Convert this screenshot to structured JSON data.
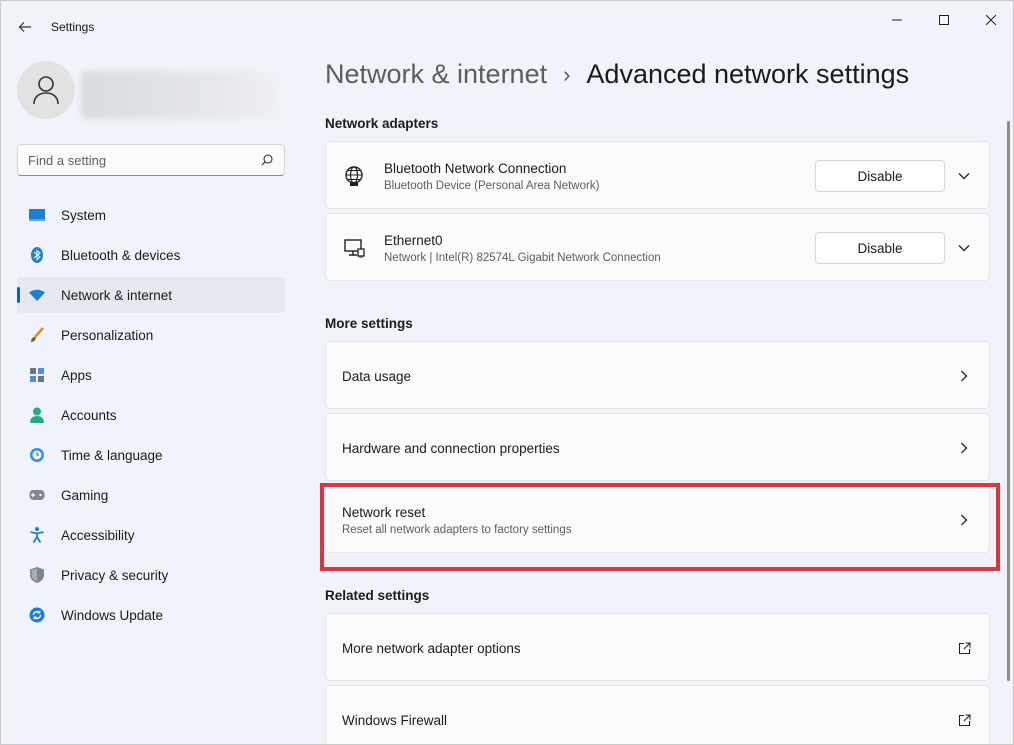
{
  "window": {
    "title": "Settings"
  },
  "sidebar": {
    "search_placeholder": "Find a setting",
    "items": [
      {
        "label": "System",
        "icon": "system-icon"
      },
      {
        "label": "Bluetooth & devices",
        "icon": "bluetooth-icon"
      },
      {
        "label": "Network & internet",
        "icon": "wifi-icon",
        "active": true
      },
      {
        "label": "Personalization",
        "icon": "brush-icon"
      },
      {
        "label": "Apps",
        "icon": "apps-icon"
      },
      {
        "label": "Accounts",
        "icon": "accounts-icon"
      },
      {
        "label": "Time & language",
        "icon": "time-language-icon"
      },
      {
        "label": "Gaming",
        "icon": "gaming-icon"
      },
      {
        "label": "Accessibility",
        "icon": "accessibility-icon"
      },
      {
        "label": "Privacy & security",
        "icon": "shield-icon"
      },
      {
        "label": "Windows Update",
        "icon": "update-icon"
      }
    ]
  },
  "main": {
    "breadcrumb": {
      "parent": "Network & internet",
      "separator": "›",
      "current": "Advanced network settings"
    },
    "adapters": {
      "title": "Network adapters",
      "items": [
        {
          "name": "Bluetooth Network Connection",
          "description": "Bluetooth Device (Personal Area Network)",
          "button": "Disable"
        },
        {
          "name": "Ethernet0",
          "description": "Network | Intel(R) 82574L Gigabit Network Connection",
          "button": "Disable"
        }
      ]
    },
    "more": {
      "title": "More settings",
      "items": [
        {
          "label": "Data usage"
        },
        {
          "label": "Hardware and connection properties"
        },
        {
          "label": "Network reset",
          "description": "Reset all network adapters to factory settings",
          "highlighted": true
        }
      ]
    },
    "related": {
      "title": "Related settings",
      "items": [
        {
          "label": "More network adapter options"
        },
        {
          "label": "Windows Firewall"
        }
      ]
    }
  },
  "colors": {
    "accent": "#0067c0",
    "highlight": "#d9363e",
    "background": "#f0f3f9",
    "card": "#fbfbfb"
  }
}
